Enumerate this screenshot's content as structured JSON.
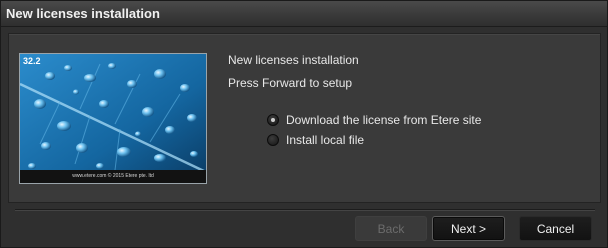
{
  "window": {
    "title": "New licenses installation"
  },
  "hero": {
    "version": "32.2",
    "footer_text": "www.etere.com © 2015 Etere pte. ltd"
  },
  "info": {
    "title": "New licenses installation",
    "subtitle": "Press Forward to setup"
  },
  "options": [
    {
      "label": "Download the license from Etere site",
      "selected": true
    },
    {
      "label": "Install local file",
      "selected": false
    }
  ],
  "buttons": {
    "back": "Back",
    "next": "Next >",
    "cancel": "Cancel"
  },
  "colors": {
    "background": "#2f2f2f",
    "panel": "#3a3a3a",
    "hero_blue": "#0f4c7a"
  }
}
